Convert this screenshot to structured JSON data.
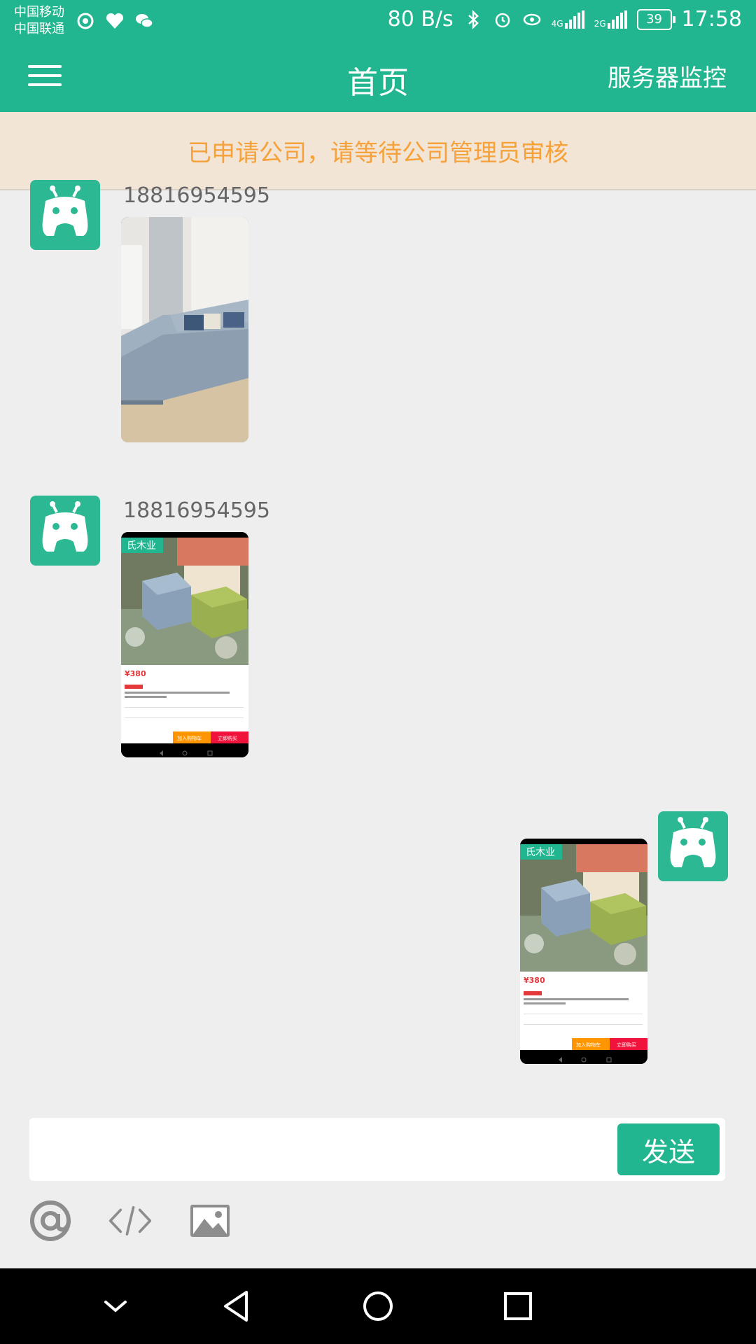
{
  "status_bar": {
    "carrier_1": "中国移动",
    "carrier_2": "中国联通",
    "net_speed": "80 B/s",
    "net_4g": "4G",
    "net_2g": "2G",
    "battery": "39",
    "time": "17:58"
  },
  "app_bar": {
    "title": "首页",
    "right_action": "服务器监控"
  },
  "notice": {
    "text": "已申请公司，请等待公司管理员审核"
  },
  "messages": [
    {
      "sender": "18816954595",
      "side": "left",
      "content": "image-sofa-bed"
    },
    {
      "sender": "18816954595",
      "side": "left",
      "content": "image-product-screenshot"
    },
    {
      "sender": "",
      "side": "right",
      "content": "image-product-screenshot"
    }
  ],
  "product_screenshot": {
    "brand": "氏木业",
    "price": "¥380",
    "add_cart": "加入购物车",
    "buy_now": "立即购买"
  },
  "composer": {
    "placeholder": "",
    "send_label": "发送"
  },
  "toolbar_icons": [
    "at-icon",
    "code-icon",
    "image-icon"
  ],
  "nav_icons": [
    "chevron-down-icon",
    "back-icon",
    "home-icon",
    "recents-icon"
  ],
  "colors": {
    "primary": "#21b68f",
    "notice_bg": "#f3e5d6",
    "notice_text": "#f6a13a",
    "background": "#eeeeee"
  }
}
